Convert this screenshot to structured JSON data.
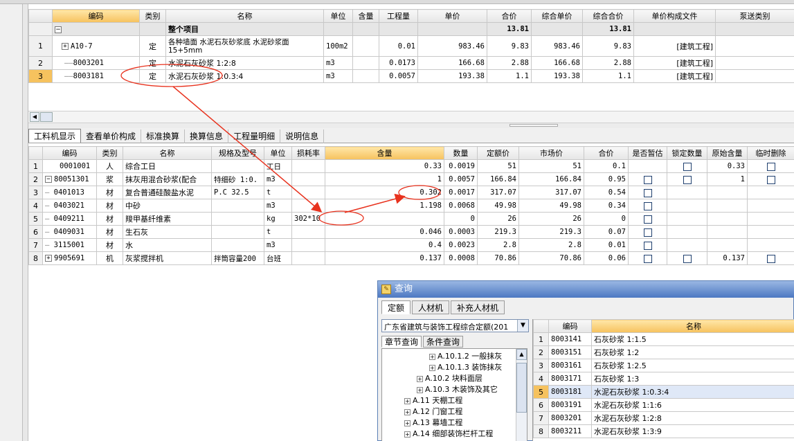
{
  "top_grid": {
    "headers": [
      "编码",
      "类别",
      "名称",
      "单位",
      "含量",
      "工程量",
      "单价",
      "合价",
      "综合单价",
      "综合合价",
      "单价构成文件",
      "泵送类别"
    ],
    "root": {
      "name": "整个项目",
      "total": "13.81",
      "comp_total": "13.81"
    },
    "rows": [
      {
        "no": "1",
        "code": "A10-7",
        "type": "定",
        "name": "各种墙面 水泥石灰砂浆底 水泥砂浆面 15+5mm",
        "unit": "100m2",
        "content": "",
        "qty": "0.01",
        "price": "983.46",
        "total": "9.83",
        "comp_price": "983.46",
        "comp_total": "9.83",
        "file": "[建筑工程]"
      },
      {
        "no": "2",
        "code": "8003201",
        "type": "定",
        "name": "水泥石灰砂浆 1:2:8",
        "unit": "m3",
        "content": "",
        "qty": "0.0173",
        "price": "166.68",
        "total": "2.88",
        "comp_price": "166.68",
        "comp_total": "2.88",
        "file": "[建筑工程]"
      },
      {
        "no": "3",
        "code": "8003181",
        "type": "定",
        "name": "水泥石灰砂浆 1:0.3:4",
        "unit": "m3",
        "content": "",
        "qty": "0.0057",
        "price": "193.38",
        "total": "1.1",
        "comp_price": "193.38",
        "comp_total": "1.1",
        "file": "[建筑工程]"
      }
    ]
  },
  "tabs": [
    "工料机显示",
    "查看单价构成",
    "标准换算",
    "换算信息",
    "工程量明细",
    "说明信息"
  ],
  "bottom_grid": {
    "headers": [
      "编码",
      "类别",
      "名称",
      "规格及型号",
      "单位",
      "损耗率",
      "含量",
      "数量",
      "定额价",
      "市场价",
      "合价",
      "是否暂估",
      "锁定数量",
      "原始含量",
      "临时删除"
    ],
    "rows": [
      {
        "no": "1",
        "code": "0001001",
        "type": "人",
        "name": "综合工日",
        "spec": "",
        "unit": "工日",
        "loss": "",
        "content": "0.33",
        "qty": "0.0019",
        "quota": "51",
        "market": "51",
        "total": "0.1",
        "orig": "0.33"
      },
      {
        "no": "2",
        "code": "80051301",
        "type": "浆",
        "name": "抹灰用混合砂浆(配合",
        "spec": "特细砂 1:0.",
        "unit": "m3",
        "loss": "",
        "content": "1",
        "qty": "0.0057",
        "quota": "166.84",
        "market": "166.84",
        "total": "0.95",
        "orig": "1"
      },
      {
        "no": "3",
        "code": "0401013",
        "type": "材",
        "name": "复合普通硅酸盐水泥",
        "spec": "P.C 32.5",
        "unit": "t",
        "loss": "",
        "content": "0.302",
        "qty": "0.0017",
        "quota": "317.07",
        "market": "317.07",
        "total": "0.54",
        "orig": ""
      },
      {
        "no": "4",
        "code": "0403021",
        "type": "材",
        "name": "中砂",
        "spec": "",
        "unit": "m3",
        "loss": "",
        "content": "1.198",
        "qty": "0.0068",
        "quota": "49.98",
        "market": "49.98",
        "total": "0.34",
        "orig": ""
      },
      {
        "no": "5",
        "code": "0409211",
        "type": "材",
        "name": "羧甲基纤维素",
        "spec": "",
        "unit": "kg",
        "loss": "302*10",
        "content": "",
        "qty": "0",
        "quota": "26",
        "market": "26",
        "total": "0",
        "orig": ""
      },
      {
        "no": "6",
        "code": "0409031",
        "type": "材",
        "name": "生石灰",
        "spec": "",
        "unit": "t",
        "loss": "",
        "content": "0.046",
        "qty": "0.0003",
        "quota": "219.3",
        "market": "219.3",
        "total": "0.07",
        "orig": ""
      },
      {
        "no": "7",
        "code": "3115001",
        "type": "材",
        "name": "水",
        "spec": "",
        "unit": "m3",
        "loss": "",
        "content": "0.4",
        "qty": "0.0023",
        "quota": "2.8",
        "market": "2.8",
        "total": "0.01",
        "orig": ""
      },
      {
        "no": "8",
        "code": "9905691",
        "type": "机",
        "name": "灰浆搅拌机",
        "spec": "拌筒容量200",
        "unit": "台班",
        "loss": "",
        "content": "0.137",
        "qty": "0.0008",
        "quota": "70.86",
        "market": "70.86",
        "total": "0.06",
        "orig": "0.137"
      }
    ]
  },
  "dialog": {
    "title": "查询",
    "tabs": [
      "定额",
      "人材机",
      "补充人材机"
    ],
    "library": "广东省建筑与装饰工程综合定额(201",
    "subtabs": [
      "章节查询",
      "条件查询"
    ],
    "tree": [
      {
        "label": "A.10.1.2 一般抹灰",
        "indent": 3
      },
      {
        "label": "A.10.1.3 装饰抹灰",
        "indent": 3
      },
      {
        "label": "A.10.2 块料面层",
        "indent": 2
      },
      {
        "label": "A.10.3 木装饰及其它",
        "indent": 2
      },
      {
        "label": "A.11 天棚工程",
        "indent": 1
      },
      {
        "label": "A.12 门窗工程",
        "indent": 1
      },
      {
        "label": "A.13 幕墙工程",
        "indent": 1
      },
      {
        "label": "A.14 细部装饰栏杆工程",
        "indent": 1
      }
    ],
    "headers": [
      "编码",
      "名称"
    ],
    "rows": [
      {
        "no": "1",
        "code": "8003141",
        "name": "石灰砂浆 1:1.5"
      },
      {
        "no": "2",
        "code": "8003151",
        "name": "石灰砂浆 1:2"
      },
      {
        "no": "3",
        "code": "8003161",
        "name": "石灰砂浆 1:2.5"
      },
      {
        "no": "4",
        "code": "8003171",
        "name": "石灰砂浆 1:3"
      },
      {
        "no": "5",
        "code": "8003181",
        "name": "水泥石灰砂浆 1:0.3:4"
      },
      {
        "no": "6",
        "code": "8003191",
        "name": "水泥石灰砂浆 1:1:6"
      },
      {
        "no": "7",
        "code": "8003201",
        "name": "水泥石灰砂浆 1:2:8"
      },
      {
        "no": "8",
        "code": "8003211",
        "name": "水泥石灰砂浆 1:3:9"
      }
    ]
  },
  "colors": {
    "accent": "#f6c25e",
    "annotation": "#e8321e",
    "dialog_title": "#4c78c2"
  }
}
